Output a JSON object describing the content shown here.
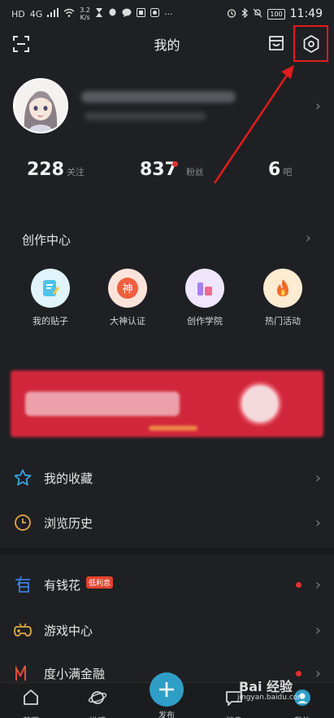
{
  "status_bar": {
    "network_label": "HD",
    "signal_label": "4G",
    "speed_value": "3.2",
    "speed_unit": "K/s",
    "more_dots": "···",
    "battery_label": "100",
    "time": "11:49"
  },
  "topbar": {
    "title": "我的"
  },
  "profile": {
    "avatar": "avatar-illustration"
  },
  "stats": {
    "following_count": "228",
    "following_label": "关注",
    "followers_count": "837",
    "followers_label": "粉丝",
    "bars_count": "6",
    "bars_label": "吧"
  },
  "creation_center": {
    "title": "创作中心",
    "items": [
      {
        "label": "我的贴子",
        "icon": "note-icon",
        "color": "#7ecfe8"
      },
      {
        "label": "大神认证",
        "icon": "shen-icon",
        "glyph": "神",
        "color": "#f07a5a"
      },
      {
        "label": "创作学院",
        "icon": "chart-icon",
        "color": "#c6a6f0"
      },
      {
        "label": "热门活动",
        "icon": "fire-icon",
        "color": "#f6b45a"
      }
    ]
  },
  "menu": {
    "favorites": "我的收藏",
    "history": "浏览历史",
    "youqianhua": "有钱花",
    "youqianhua_badge": "低利息",
    "game_center": "游戏中心",
    "finance": "度小满金融"
  },
  "tabbar": {
    "home": "首页",
    "jinba": "进吧",
    "publish": "发布",
    "messages": "消息",
    "mine": "我的"
  },
  "watermark": {
    "text": "Bai 经验",
    "url": "jingyan.baidu.com"
  },
  "colors": {
    "background": "#1f2023",
    "highlight": "#e11c1c",
    "accent_blue": "#2f9ec6",
    "badge_red": "#e0432d"
  }
}
